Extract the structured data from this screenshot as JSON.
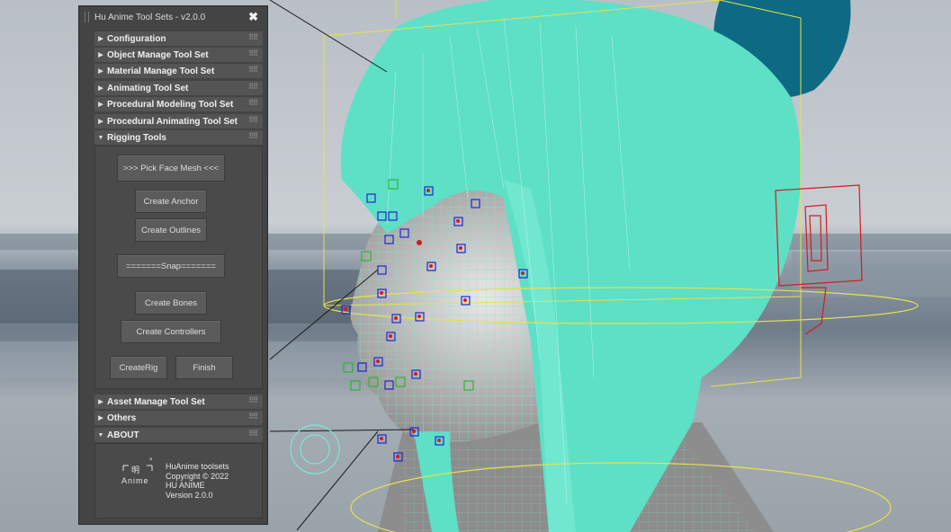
{
  "panel": {
    "title": "Hu Anime Tool Sets - v2.0.0",
    "close_glyph": "✖",
    "rollouts_top": [
      {
        "label": "Configuration",
        "expanded": false
      },
      {
        "label": "Object Manage Tool Set",
        "expanded": false
      },
      {
        "label": "Material Manage Tool Set",
        "expanded": false
      },
      {
        "label": "Animating Tool Set",
        "expanded": false
      },
      {
        "label": "Procedural Modeling Tool Set",
        "expanded": false
      },
      {
        "label": "Procedural Animating Tool Set",
        "expanded": false
      },
      {
        "label": "Rigging Tools",
        "expanded": true
      }
    ],
    "rigging": {
      "pick_face_mesh": ">>> Pick Face Mesh <<<",
      "create_anchor": "Create Anchor",
      "create_outlines": "Create Outlines",
      "snap": "=======Snap=======",
      "create_bones": "Create Bones",
      "create_controllers": "Create Controllers",
      "create_rig": "CreateRig",
      "finish": "Finish"
    },
    "rollouts_bottom": [
      {
        "label": "Asset Manage Tool Set",
        "expanded": false
      },
      {
        "label": "Others",
        "expanded": false
      },
      {
        "label": "ABOUT",
        "expanded": true
      }
    ],
    "about": {
      "logo_char": "明",
      "logo_word": "Anime",
      "logo_mark": "°",
      "lines": [
        "HuAnime toolsets",
        "Copyright © 2022",
        "HU ANIME",
        "Version 2.0.0"
      ]
    }
  },
  "colors": {
    "hair": "#5de0c6",
    "bun": "#0d6a82",
    "panel_bg": "#444444",
    "bbox_yellow": "#e7e24a",
    "controller_red": "#d21c1c"
  }
}
